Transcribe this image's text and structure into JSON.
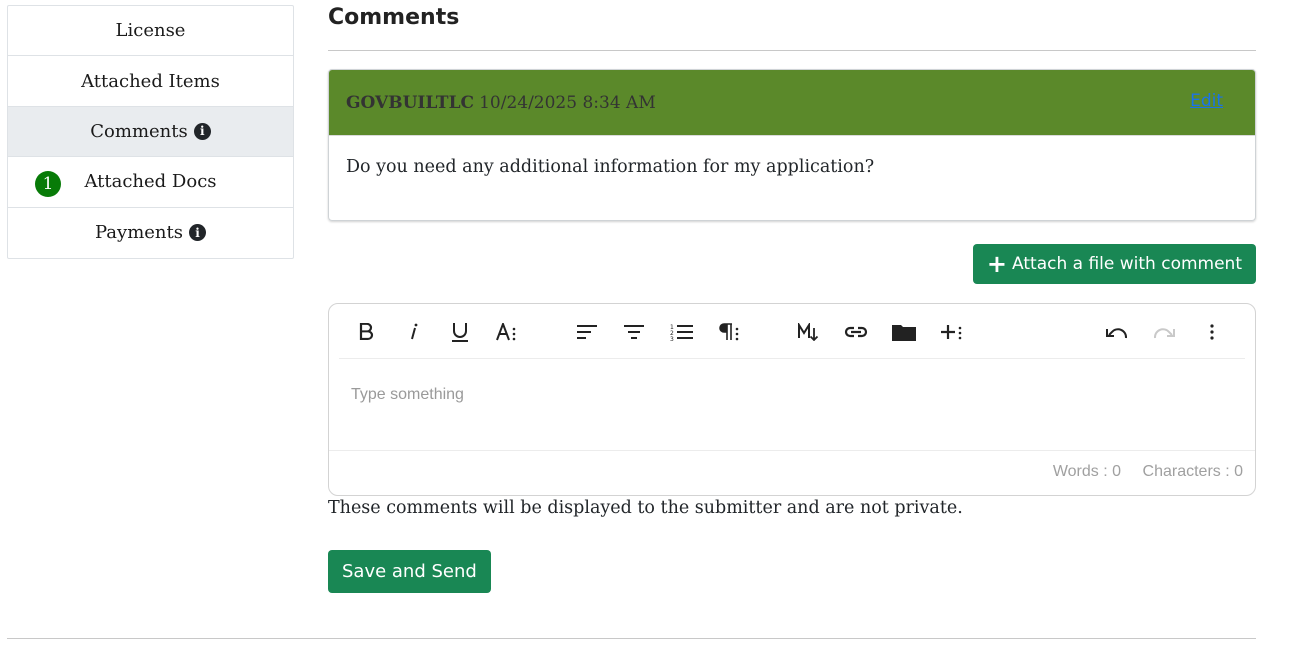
{
  "sidebar": {
    "items": [
      {
        "label": "License",
        "info": false
      },
      {
        "label": "Attached Items",
        "info": false
      },
      {
        "label": "Comments",
        "info": true
      },
      {
        "label": "Attached Docs",
        "badge": "1"
      },
      {
        "label": "Payments",
        "info": true
      }
    ]
  },
  "main": {
    "title": "Comments",
    "comment": {
      "author": "GOVBUILTLC",
      "timestamp": "10/24/2025 8:34 AM",
      "edit_label": "Edit",
      "body": "Do you need any additional information for my application?"
    },
    "attach_button": {
      "icon": "plus-icon",
      "label": "Attach a file with comment"
    },
    "editor": {
      "toolbar": [
        "bold-icon",
        "italic-icon",
        "underline-icon",
        "font-size-icon",
        "align-left-icon",
        "align-center-icon",
        "ordered-list-icon",
        "paragraph-icon",
        "markdown-icon",
        "link-icon",
        "folder-icon",
        "insert-icon",
        "undo-icon",
        "redo-icon",
        "more-icon"
      ],
      "placeholder": "Type something",
      "words_label": "Words : 0",
      "characters_label": "Characters : 0"
    },
    "notice": "These comments will be displayed to the submitter and are not private.",
    "save_button": "Save and Send"
  },
  "colors": {
    "header_green": "#5b892a",
    "button_green": "#198754",
    "badge_green": "#087b08",
    "link_blue": "#1a73e8",
    "active_bg": "#e9ecef"
  }
}
